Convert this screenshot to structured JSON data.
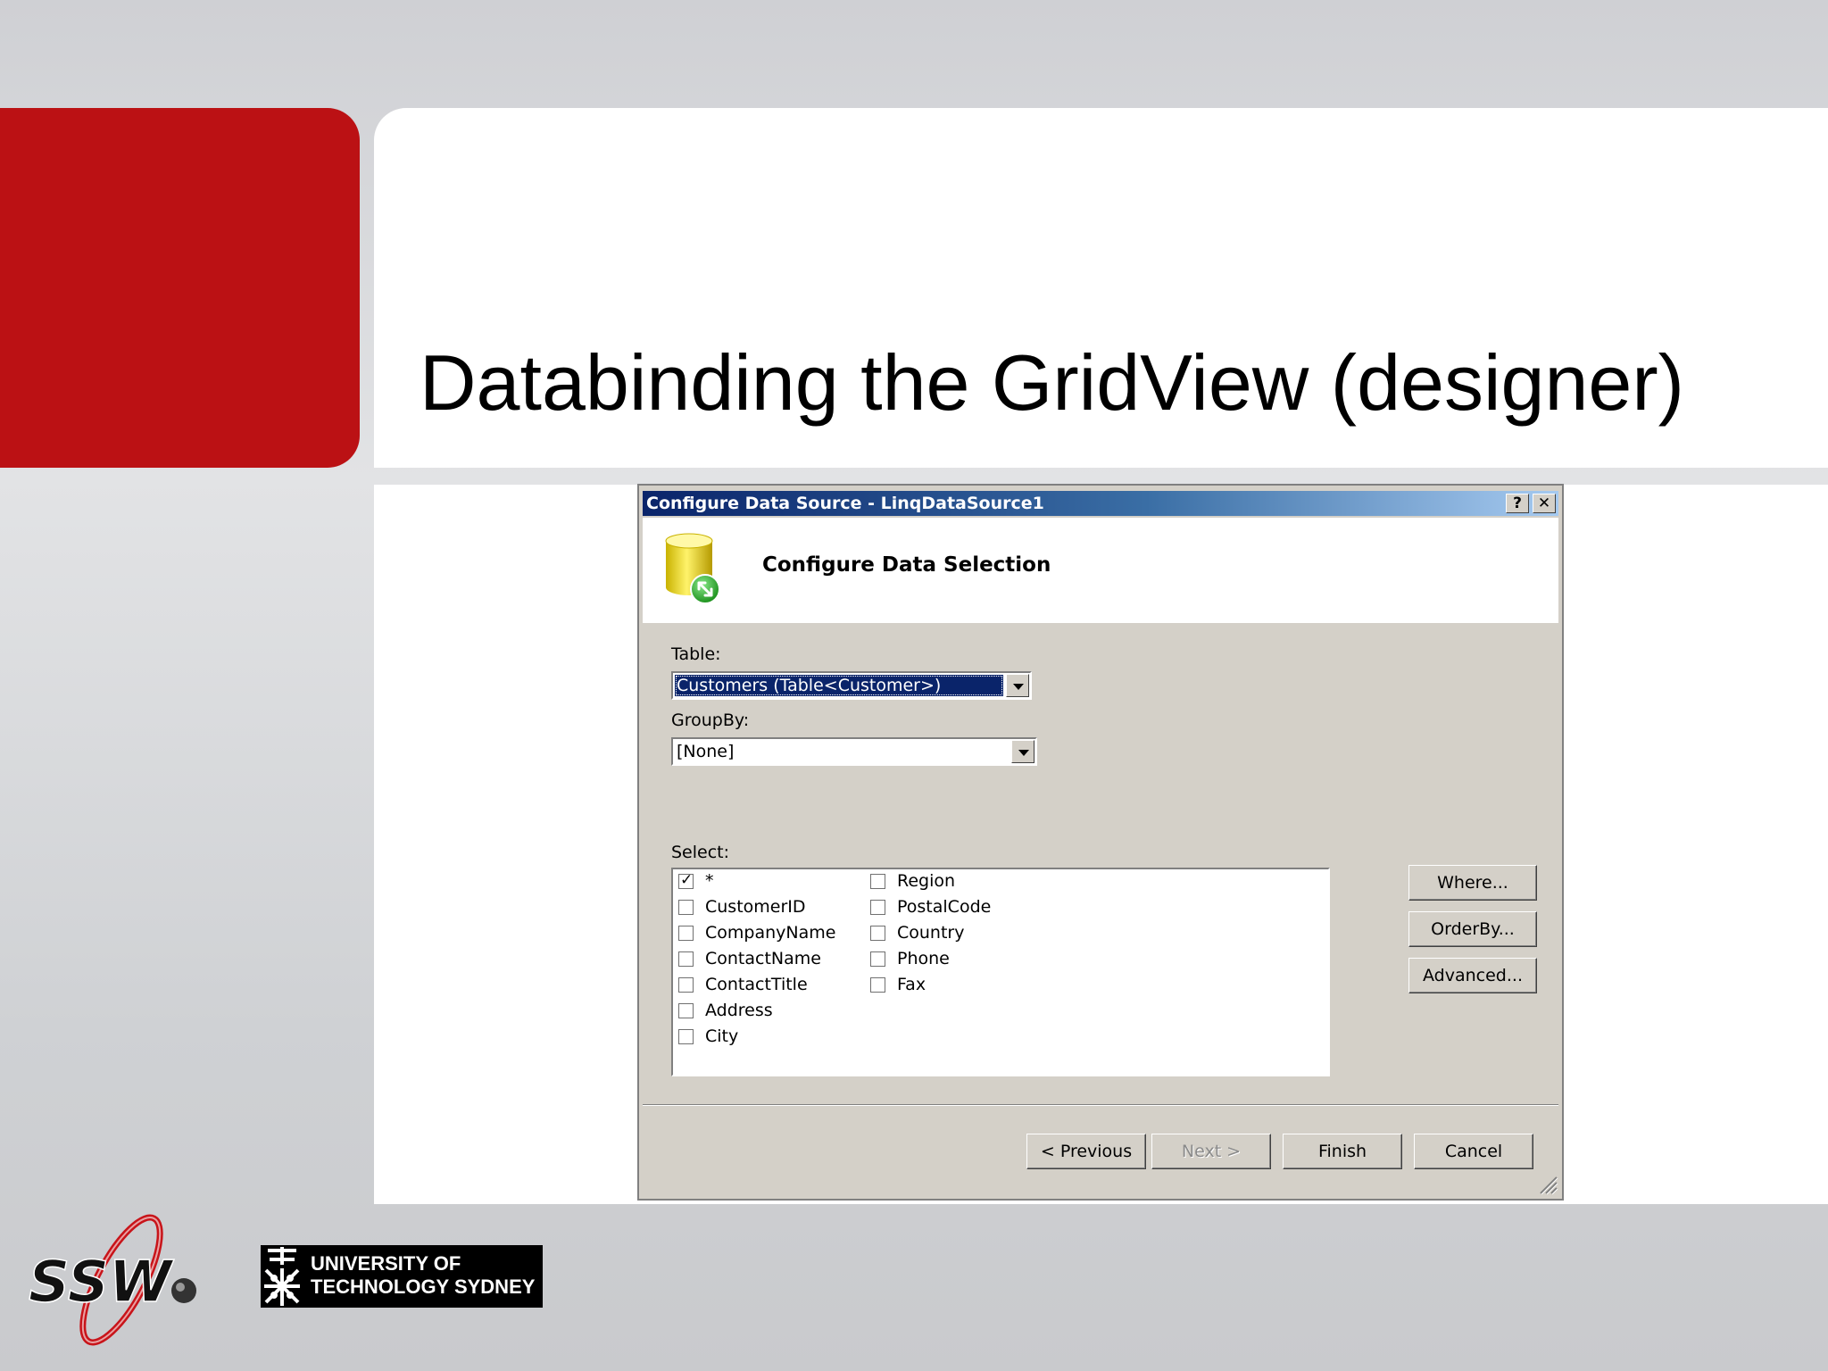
{
  "slide": {
    "title": "Databinding the GridView (designer)"
  },
  "dialog": {
    "title": "Configure Data Source - LinqDataSource1",
    "help_label": "?",
    "close_label": "✕",
    "header_title": "Configure Data Selection",
    "table_label": "Table:",
    "table_value": "Customers (Table<Customer>)",
    "groupby_label": "GroupBy:",
    "groupby_value": "[None]",
    "select_label": "Select:",
    "columns": [
      {
        "label": "*",
        "checked": true
      },
      {
        "label": "CustomerID",
        "checked": false
      },
      {
        "label": "CompanyName",
        "checked": false
      },
      {
        "label": "ContactName",
        "checked": false
      },
      {
        "label": "ContactTitle",
        "checked": false
      },
      {
        "label": "Address",
        "checked": false
      },
      {
        "label": "City",
        "checked": false
      },
      {
        "label": "Region",
        "checked": false
      },
      {
        "label": "PostalCode",
        "checked": false
      },
      {
        "label": "Country",
        "checked": false
      },
      {
        "label": "Phone",
        "checked": false
      },
      {
        "label": "Fax",
        "checked": false
      }
    ],
    "where_label": "Where...",
    "orderby_label": "OrderBy...",
    "advanced_label": "Advanced...",
    "previous_label": "< Previous",
    "next_label": "Next >",
    "finish_label": "Finish",
    "cancel_label": "Cancel"
  },
  "logos": {
    "uts_line1": "UNIVERSITY OF",
    "uts_line2": "TECHNOLOGY SYDNEY"
  },
  "colors": {
    "brand_red": "#bb1114",
    "titlebar_dark": "#0a246a",
    "dialog_face": "#d4d0c8"
  }
}
